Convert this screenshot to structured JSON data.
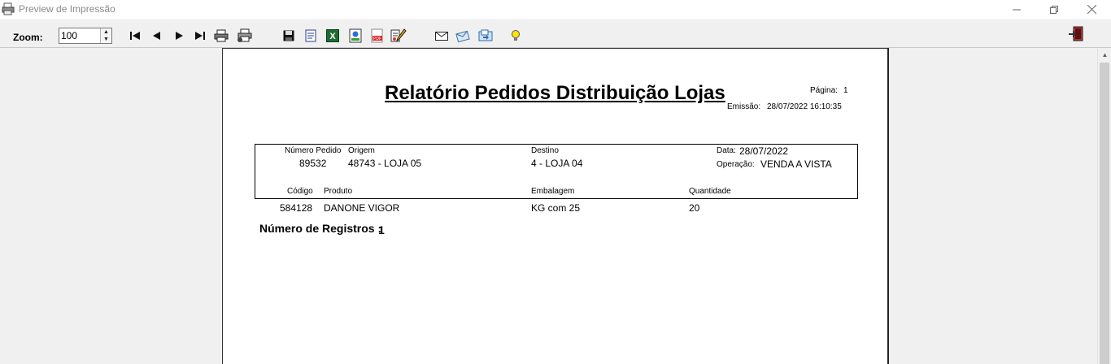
{
  "window": {
    "title": "Preview de Impressão"
  },
  "toolbar": {
    "zoom_label": "Zoom:",
    "zoom_value": "100",
    "icons": [
      "first-page-icon",
      "prev-page-icon",
      "next-page-icon",
      "last-page-icon",
      "print-icon",
      "print-setup-icon",
      "save-icon",
      "export-rtf-icon",
      "export-excel-icon",
      "export-html-icon",
      "export-pdf-icon",
      "edit-icon",
      "email-icon",
      "email-send-icon",
      "fax-icon",
      "tip-icon",
      "exit-icon"
    ]
  },
  "report": {
    "title": "Relatório Pedidos Distribuição Lojas",
    "page_label": "Página:",
    "page_value": "1",
    "emission_label": "Emissão:",
    "emission_value": "28/07/2022 16:10:35",
    "header": {
      "numero_pedido_label": "Número Pedido",
      "numero_pedido_value": "89532",
      "origem_label": "Origem",
      "origem_value": "48743 - LOJA 05",
      "destino_label": "Destino",
      "destino_value": "4 - LOJA 04",
      "data_label": "Data:",
      "data_value": "28/07/2022",
      "operacao_label": "Operação:",
      "operacao_value": "VENDA A VISTA"
    },
    "columns": {
      "codigo": "Código",
      "produto": "Produto",
      "embalagem": "Embalagem",
      "quantidade": "Quantidade"
    },
    "rows": [
      {
        "codigo": "584128",
        "produto": "DANONE VIGOR",
        "embalagem": "KG com 25",
        "quantidade": "20"
      }
    ],
    "registros_label": "Número de Registros :",
    "registros_value": "1"
  }
}
